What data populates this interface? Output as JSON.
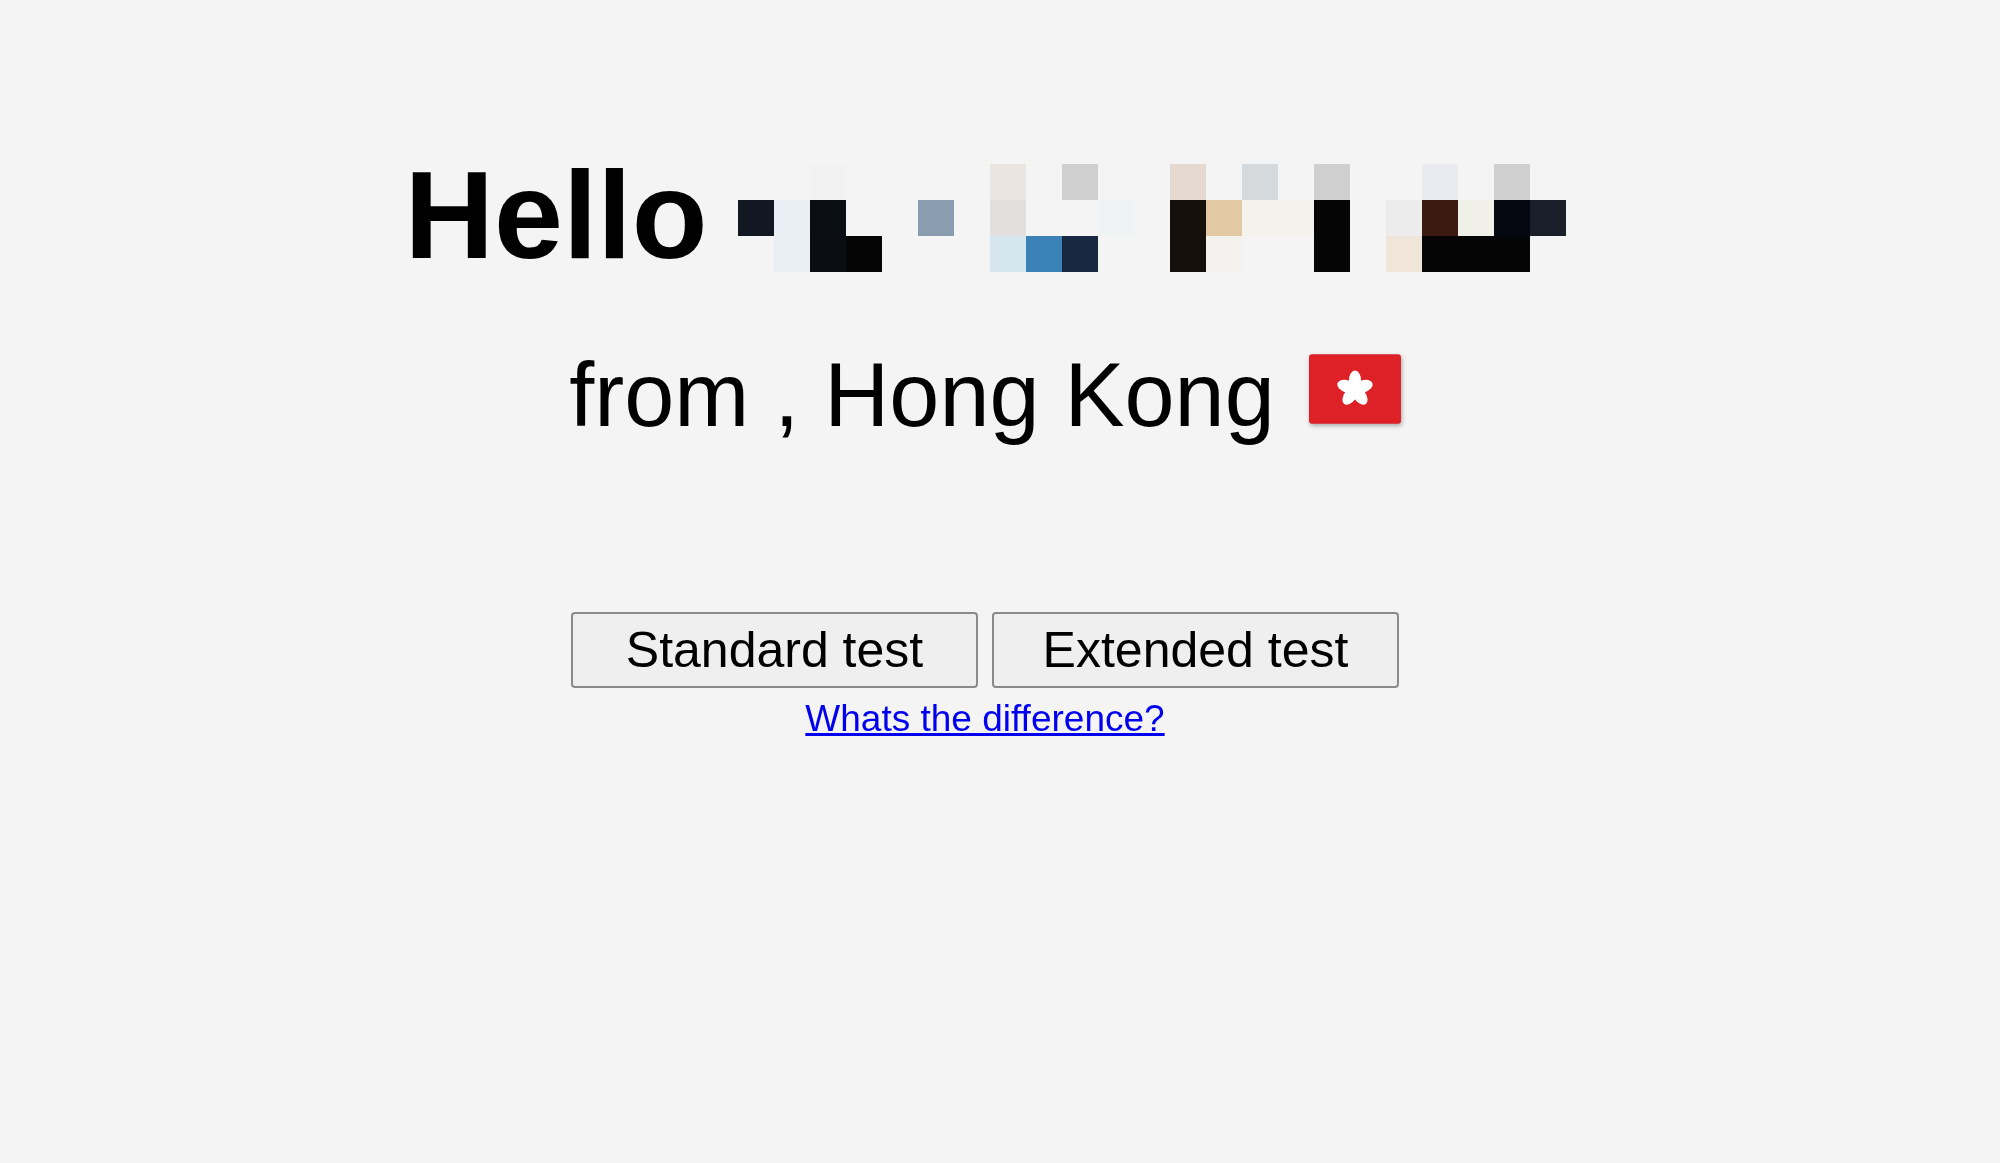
{
  "greeting": {
    "text": "Hello",
    "redacted": true
  },
  "location": {
    "text": "from , Hong Kong"
  },
  "buttons": [
    "Standard test",
    "Extended test"
  ],
  "link": "Whats the difference?"
}
